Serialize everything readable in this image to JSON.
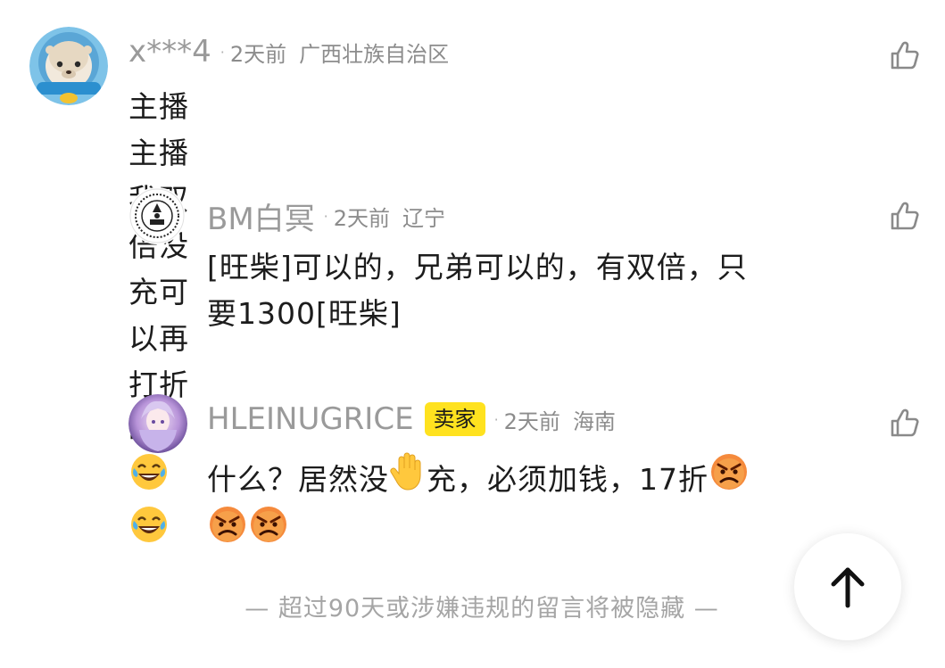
{
  "comments": [
    {
      "username": "x***4",
      "time": "2天前",
      "location": "广西壮族自治区",
      "text": "主播主播我双倍没充可以再打折吗？",
      "emoji_after": [
        "laughing-tears",
        "laughing-tears"
      ]
    },
    {
      "username": "BM白冥",
      "time": "2天前",
      "location": "辽宁",
      "text_line1": "[旺柴]可以的，兄弟可以的，有双倍，只",
      "text_line2": "要1300[旺柴]"
    },
    {
      "username": "HLEINUGRICE",
      "badge": "卖家",
      "time": "2天前",
      "location": "海南",
      "text_part1": "什么？居然没",
      "text_part2": "充，必须加钱，17折"
    }
  ],
  "footer": {
    "note": "— 超过90天或涉嫌违规的留言将被隐藏 —"
  },
  "icons": {
    "like": "thumbs-up-icon",
    "scroll_top": "arrow-up-icon"
  },
  "colors": {
    "badge_bg": "#ffe21f",
    "meta_text": "#8c8c8c"
  }
}
